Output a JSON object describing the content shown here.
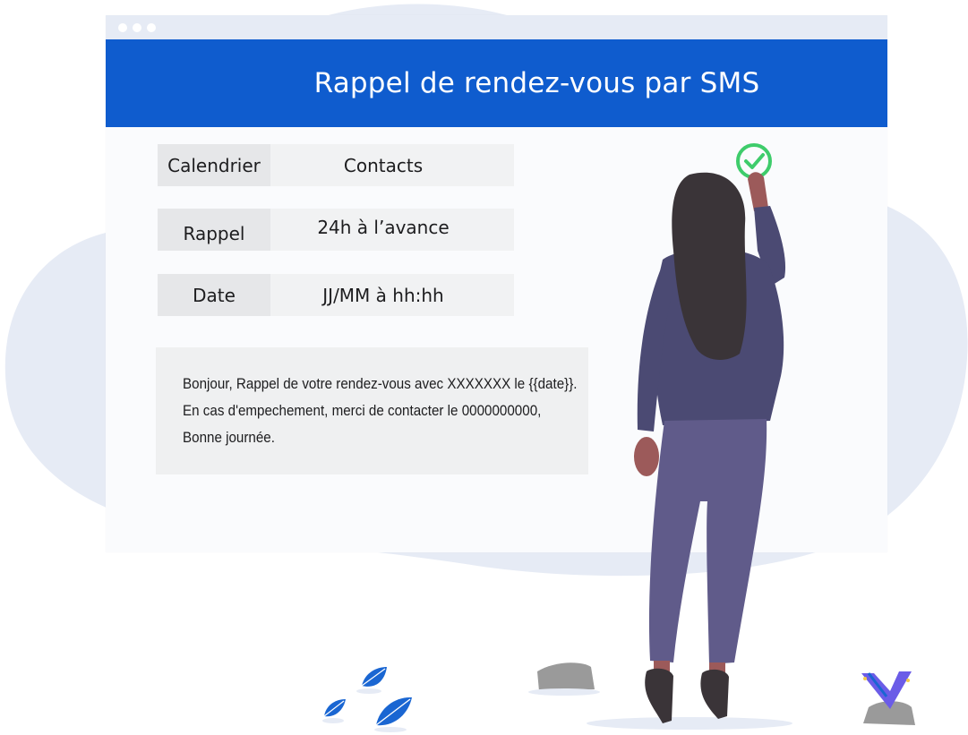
{
  "window": {
    "title": "Rappel de rendez-vous par SMS"
  },
  "fields": [
    {
      "label": "Calendrier",
      "value": "Contacts"
    },
    {
      "label": "Rappel",
      "value": "24h à l’avance"
    },
    {
      "label": "Date",
      "value": "JJ/MM à hh:hh"
    }
  ],
  "message": {
    "lines": [
      "Bonjour, Rappel de votre rendez-vous avec XXXXXXX le {{date}}.",
      "En cas d'empechement, merci de contacter le 0000000000,",
      "Bonne journée."
    ]
  },
  "colors": {
    "header": "#0f5cce",
    "blob": "#e6ebf5",
    "check": "#3ecc6b",
    "suit": "#4b4a73",
    "hair": "#3a3438",
    "skin": "#9c5a5a",
    "leaf": "#1a66d2",
    "logo": "#6b5ce7"
  },
  "icons": [
    "check-circle-icon",
    "window-dot-icon",
    "leaf-icon",
    "rock-icon",
    "logo-icon"
  ]
}
